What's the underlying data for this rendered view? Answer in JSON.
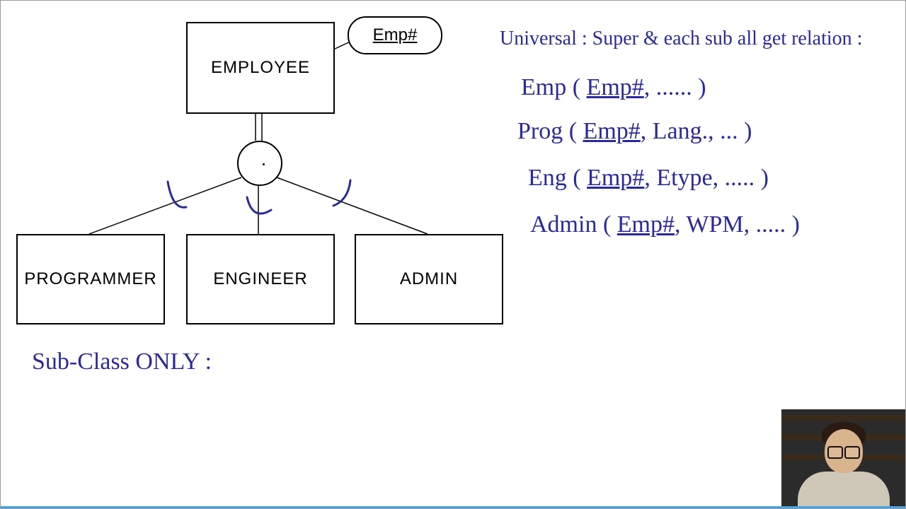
{
  "diagram": {
    "super": "EMPLOYEE",
    "key_attr": "Emp#",
    "sub1": "PROGRAMMER",
    "sub2": "ENGINEER",
    "sub3": "ADMIN"
  },
  "notes": {
    "universal_heading": "Universal : Super & each sub all get relation :",
    "rel_emp_head": "Emp ( ",
    "rel_emp_key": "Emp#",
    "rel_emp_tail": ", ...... )",
    "rel_prog_head": "Prog ( ",
    "rel_prog_key": "Emp#",
    "rel_prog_tail": ", Lang., ... )",
    "rel_eng_head": "Eng ( ",
    "rel_eng_key": "Emp#",
    "rel_eng_tail": ", Etype, ..... )",
    "rel_admin_head": "Admin ( ",
    "rel_admin_key": "Emp#",
    "rel_admin_tail": ", WPM, ..... )",
    "subclass_only": "Sub-Class ONLY :"
  }
}
